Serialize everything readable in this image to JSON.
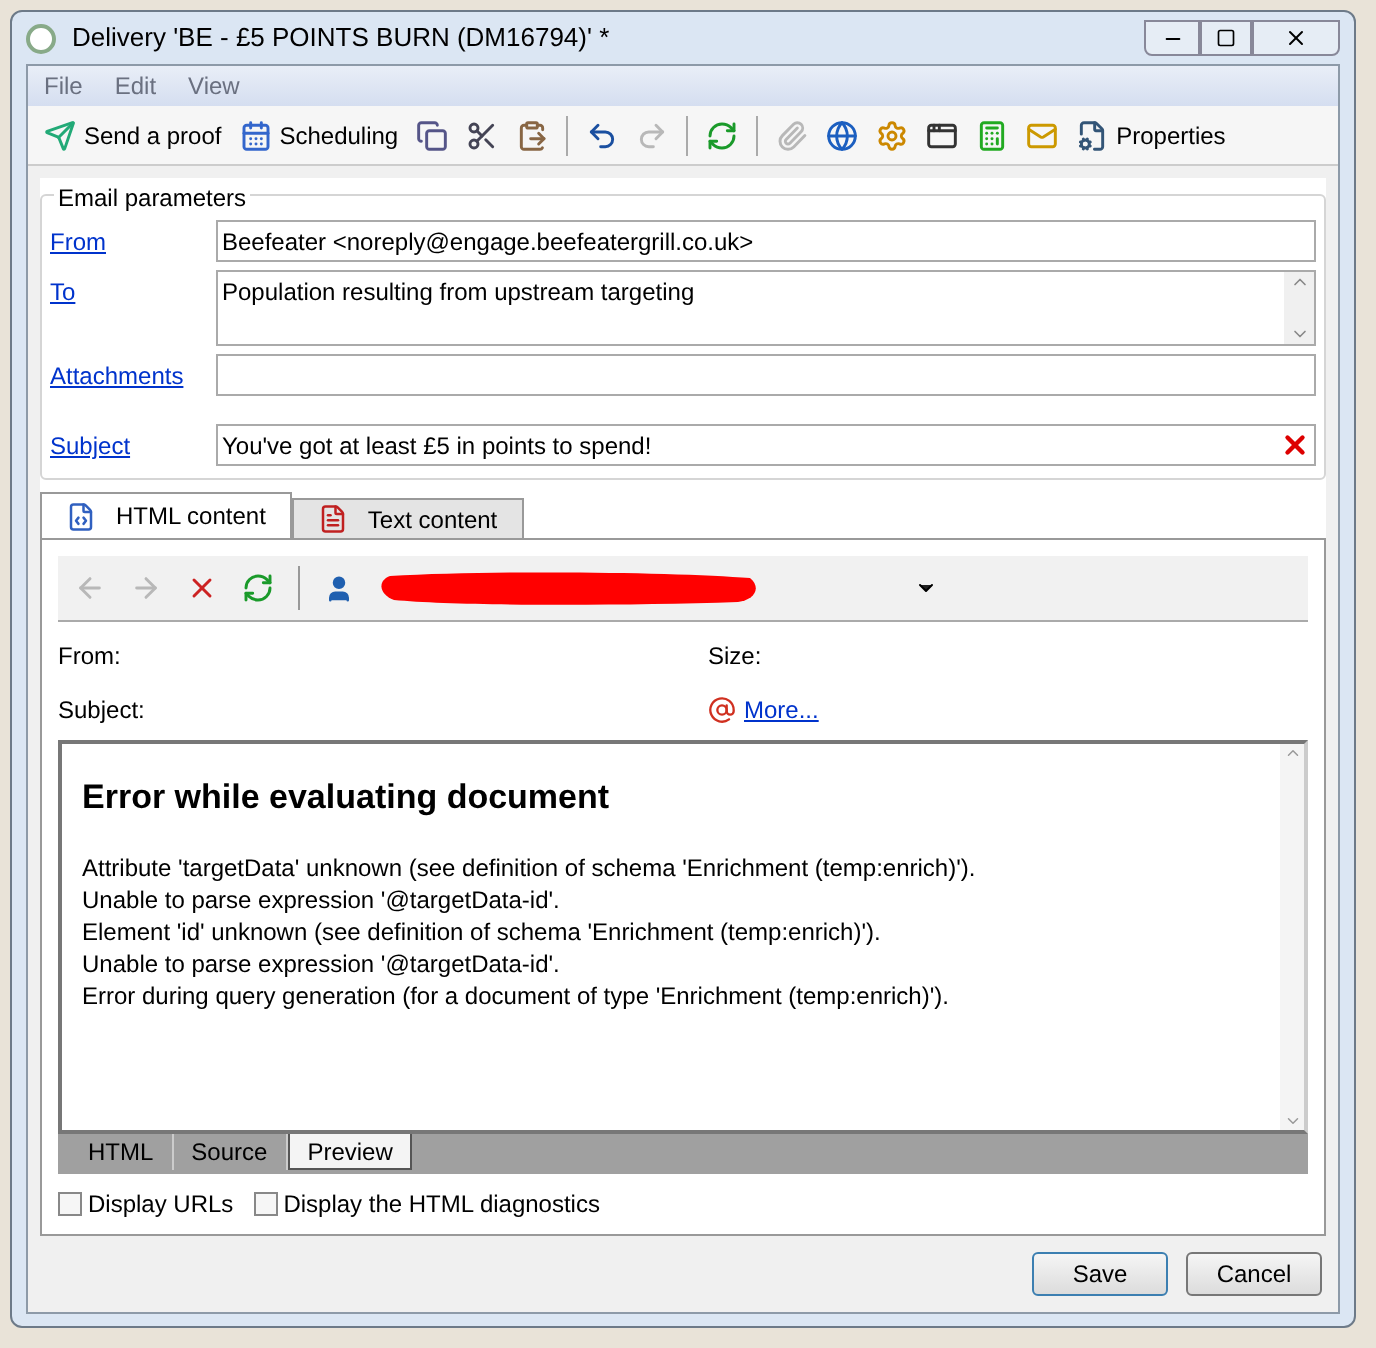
{
  "window": {
    "title": "Delivery 'BE - £5 POINTS BURN (DM16794)' *"
  },
  "menu": [
    "File",
    "Edit",
    "View"
  ],
  "toolbar": [
    {
      "kind": "proof",
      "label": "Send a proof",
      "disabled": false
    },
    {
      "kind": "calendar",
      "label": "Scheduling",
      "disabled": false
    },
    {
      "kind": "copy",
      "disabled": false
    },
    {
      "kind": "cut",
      "disabled": false
    },
    {
      "kind": "paste",
      "disabled": false
    },
    {
      "kind": "sep"
    },
    {
      "kind": "undo",
      "disabled": false
    },
    {
      "kind": "redo",
      "disabled": true
    },
    {
      "kind": "sep"
    },
    {
      "kind": "refresh",
      "disabled": false
    },
    {
      "kind": "sep"
    },
    {
      "kind": "attach",
      "disabled": true
    },
    {
      "kind": "globe",
      "disabled": false
    },
    {
      "kind": "gear",
      "disabled": false
    },
    {
      "kind": "form",
      "disabled": false
    },
    {
      "kind": "calc",
      "disabled": false
    },
    {
      "kind": "mail",
      "disabled": false
    },
    {
      "kind": "props",
      "label": "Properties",
      "disabled": false
    }
  ],
  "email_parameters": {
    "title": "Email parameters",
    "fields": [
      {
        "label": "From",
        "value": "Beefeater <noreply@engage.beefeatergrill.co.uk>",
        "kind": "line"
      },
      {
        "label": "To",
        "value": "Population resulting from upstream targeting",
        "kind": "multi"
      },
      {
        "label": "Attachments",
        "kind": "line"
      },
      {
        "label": "Subject",
        "value": "You've got at least £5 in points to spend!",
        "kind": "clear"
      }
    ]
  },
  "content_tabs": [
    {
      "label": "HTML content",
      "selected": true,
      "kind": "html"
    },
    {
      "label": "Text content",
      "selected": false,
      "kind": "text"
    }
  ],
  "preview_toolbar": [
    {
      "kind": "back",
      "disabled": true
    },
    {
      "kind": "forward",
      "disabled": true
    },
    {
      "kind": "stop",
      "disabled": false
    },
    {
      "kind": "refresh",
      "disabled": false
    }
  ],
  "preview_info": {
    "from_label": "From:",
    "size_label": "Size:",
    "subject_label": "Subject:",
    "more_link": "More..."
  },
  "document": {
    "heading": "Error while evaluating document",
    "lines": [
      "Attribute 'targetData' unknown (see definition of schema 'Enrichment (temp:enrich)').",
      "Unable to parse expression '@targetData-id'.",
      "Element 'id' unknown (see definition of schema 'Enrichment (temp:enrich)').",
      "Unable to parse expression '@targetData-id'.",
      "Error during query generation (for a document of type 'Enrichment (temp:enrich)')."
    ]
  },
  "view_tabs": [
    {
      "label": "HTML",
      "selected": false
    },
    {
      "label": "Source",
      "selected": false
    },
    {
      "label": "Preview",
      "selected": true
    }
  ],
  "options": [
    {
      "label": "Display URLs",
      "checked": false
    },
    {
      "label": "Display the HTML diagnostics",
      "checked": false
    }
  ],
  "buttons": [
    {
      "label": "Save",
      "default": true
    },
    {
      "label": "Cancel",
      "default": false
    }
  ]
}
